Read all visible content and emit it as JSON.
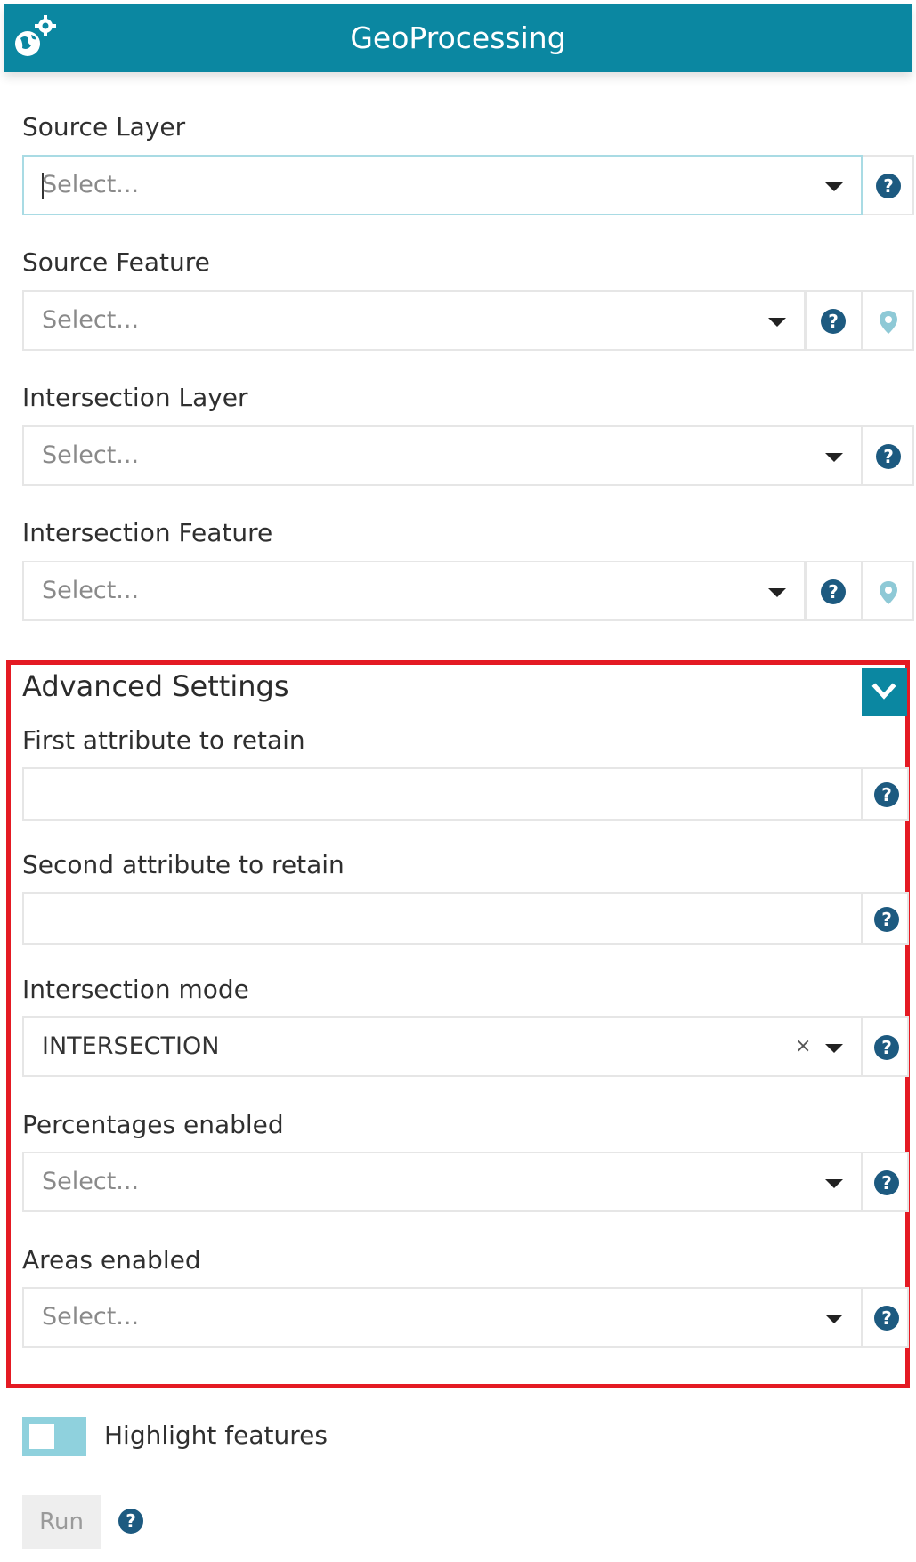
{
  "header": {
    "title": "GeoProcessing",
    "icon": "globe-gear-icon"
  },
  "colors": {
    "primary": "#0b87a1",
    "highlight_border": "#e41a23",
    "toggle_bg": "#8fd1dd"
  },
  "fields": {
    "source_layer": {
      "label": "Source Layer",
      "placeholder": "Select..."
    },
    "source_feature": {
      "label": "Source Feature",
      "placeholder": "Select..."
    },
    "intersection_layer": {
      "label": "Intersection Layer",
      "placeholder": "Select..."
    },
    "intersection_feature": {
      "label": "Intersection Feature",
      "placeholder": "Select..."
    }
  },
  "advanced": {
    "title": "Advanced Settings",
    "first_attribute": {
      "label": "First attribute to retain",
      "value": ""
    },
    "second_attribute": {
      "label": "Second attribute to retain",
      "value": ""
    },
    "intersection_mode": {
      "label": "Intersection mode",
      "value": "INTERSECTION",
      "clear": "×"
    },
    "percentages_enabled": {
      "label": "Percentages enabled",
      "placeholder": "Select..."
    },
    "areas_enabled": {
      "label": "Areas enabled",
      "placeholder": "Select..."
    }
  },
  "highlight": {
    "label": "Highlight features",
    "enabled": false
  },
  "run": {
    "label": "Run"
  }
}
